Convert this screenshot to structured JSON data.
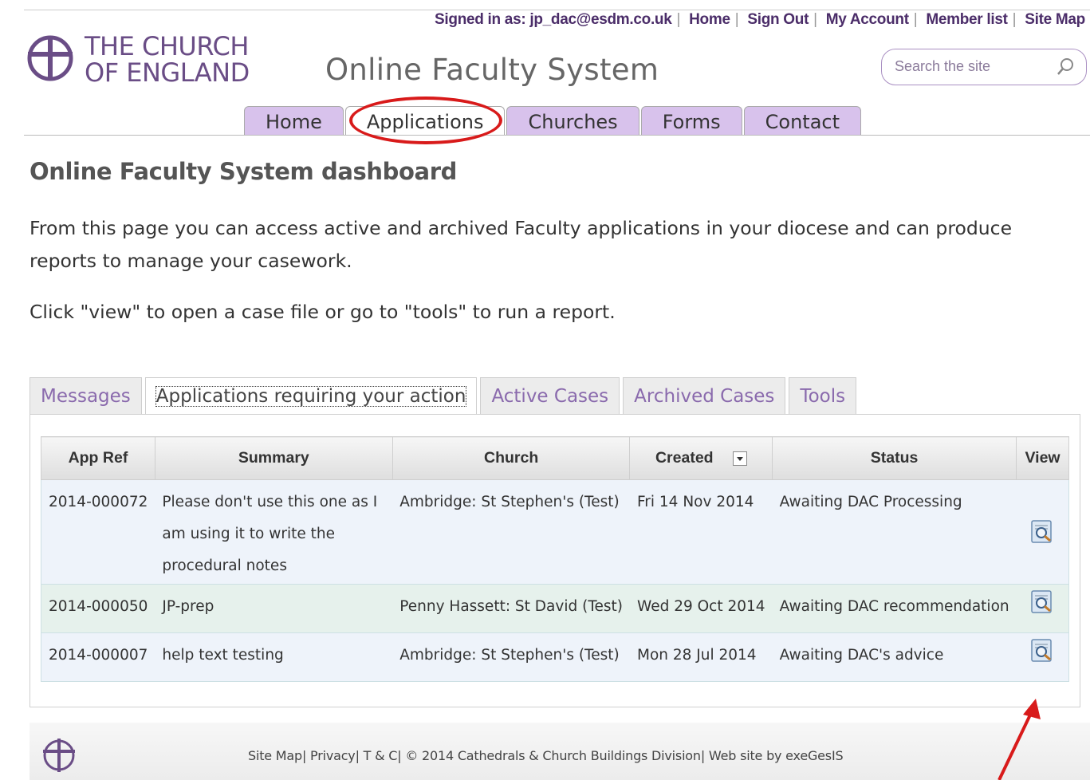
{
  "header": {
    "signed_in": "Signed in as: jp_dac@esdm.co.uk",
    "links": [
      "Home",
      "Sign Out",
      "My Account",
      "Member list",
      "Site Map"
    ],
    "logo_line1": "THE CHURCH",
    "logo_line2": "OF ENGLAND",
    "site_title": "Online Faculty System",
    "search_placeholder": "Search the site"
  },
  "nav": {
    "tabs": [
      "Home",
      "Applications",
      "Churches",
      "Forms",
      "Contact"
    ],
    "active": "Applications"
  },
  "page": {
    "title": "Online Faculty System dashboard",
    "intro": "From this page you can access active and archived Faculty applications in your diocese and can produce reports to manage your casework.",
    "instruction": "Click \"view\" to open a case file or go to \"tools\" to run a report."
  },
  "subtabs": {
    "items": [
      "Messages",
      "Applications requiring your action",
      "Active Cases",
      "Archived Cases",
      "Tools"
    ],
    "active": "Applications requiring your action"
  },
  "table": {
    "headers": [
      "App Ref",
      "Summary",
      "Church",
      "Created",
      "Status",
      "View"
    ],
    "rows": [
      {
        "ref": "2014-000072",
        "summary": "Please don't use this one as I am using it to write the procedural notes",
        "church": "Ambridge: St Stephen's (Test)",
        "created": "Fri 14 Nov 2014",
        "status": "Awaiting DAC Processing"
      },
      {
        "ref": "2014-000050",
        "summary": "JP-prep",
        "church": "Penny Hassett: St David (Test)",
        "created": "Wed 29 Oct 2014",
        "status": "Awaiting DAC recommendation"
      },
      {
        "ref": "2014-000007",
        "summary": "help text testing",
        "church": "Ambridge: St Stephen's (Test)",
        "created": "Mon 28 Jul 2014",
        "status": "Awaiting DAC's advice"
      }
    ]
  },
  "footer": {
    "text": "Site Map| Privacy| T & C| © 2014 Cathedrals & Church Buildings Division| Web site by exeGesIS"
  },
  "colors": {
    "brand_purple": "#6a4d86",
    "tab_purple": "#d8c2ec",
    "annotation_red": "#d81a1a"
  }
}
